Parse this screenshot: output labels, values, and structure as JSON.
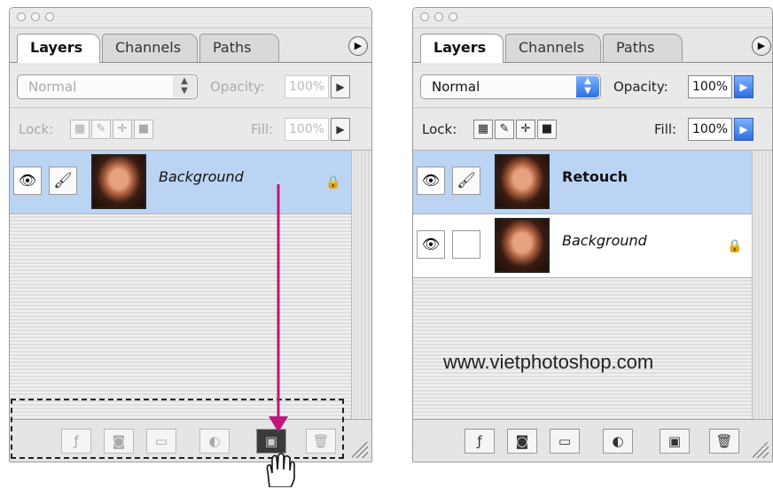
{
  "left_panel": {
    "tabs": [
      "Layers",
      "Channels",
      "Paths"
    ],
    "blend_mode": "Normal",
    "opacity_label": "Opacity:",
    "opacity_value": "100%",
    "lock_label": "Lock:",
    "fill_label": "Fill:",
    "fill_value": "100%",
    "layers": [
      {
        "name": "Background",
        "locked": true,
        "selected": true
      }
    ]
  },
  "right_panel": {
    "tabs": [
      "Layers",
      "Channels",
      "Paths"
    ],
    "blend_mode": "Normal",
    "opacity_label": "Opacity:",
    "opacity_value": "100%",
    "lock_label": "Lock:",
    "fill_label": "Fill:",
    "fill_value": "100%",
    "layers": [
      {
        "name": "Retouch",
        "locked": false,
        "selected": true
      },
      {
        "name": "Background",
        "locked": true,
        "selected": false
      }
    ]
  },
  "watermark": "www.vietphotoshop.com",
  "icons": {
    "menu": "circle-arrow-icon",
    "eye": "eye-icon",
    "brush": "brush-icon",
    "lock": "padlock-icon",
    "bottom": [
      "layer-style-icon",
      "mask-icon",
      "folder-icon",
      "adjustment-icon",
      "new-layer-icon",
      "trash-icon"
    ],
    "cursor": "hand-cursor-icon"
  },
  "colors": {
    "accent_arrow": "#c0167a",
    "selected_row": "#bcd4f4",
    "stepper_active": "#2c6fe0"
  }
}
